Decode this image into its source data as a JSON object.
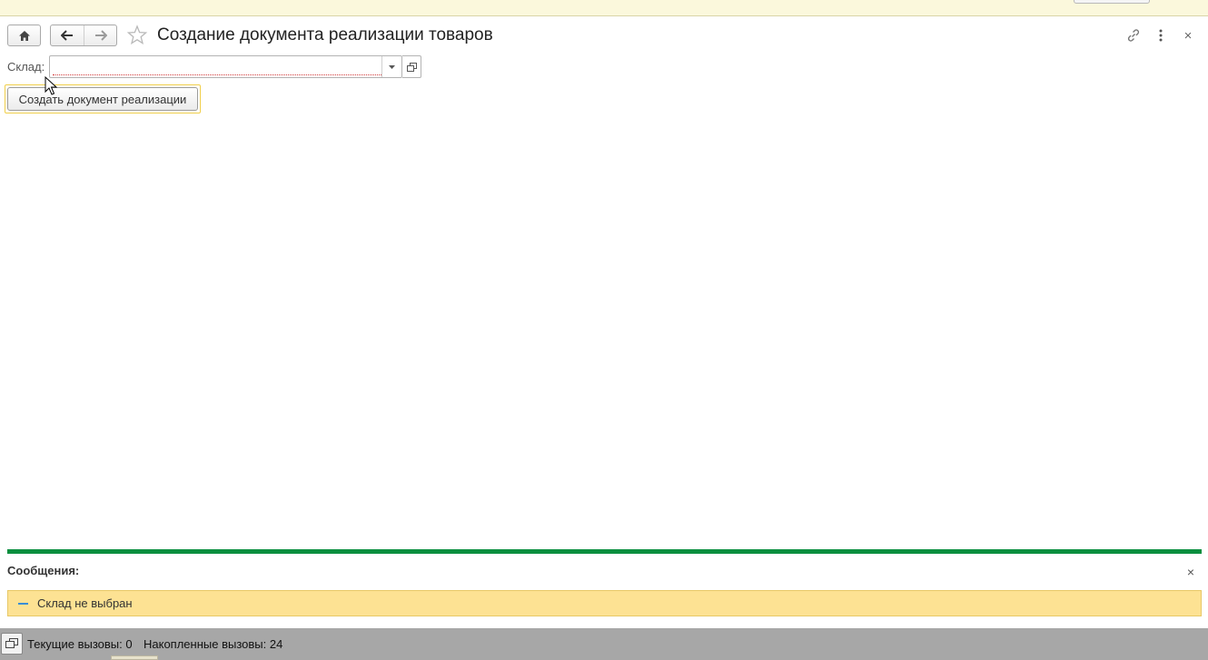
{
  "window": {
    "title": "Создание документа реализации товаров"
  },
  "nav": {
    "home_icon": "home-icon",
    "back_icon": "arrow-left-icon",
    "forward_icon": "arrow-right-icon",
    "favorite_icon": "star-icon"
  },
  "window_actions": {
    "link_icon": "link-icon",
    "more_icon": "more-vertical-icon",
    "close_icon": "close-icon",
    "close_glyph": "×"
  },
  "form": {
    "warehouse_label": "Склад:",
    "warehouse_value": "",
    "create_button_label": "Создать документ реализации"
  },
  "messages": {
    "title": "Сообщения:",
    "close_glyph": "×",
    "items": [
      {
        "text": "Склад не выбран"
      }
    ],
    "separator_color": "#0a8f3f",
    "item_background": "#fde293"
  },
  "status_bar": {
    "current_calls": "Текущие вызовы: 0",
    "accumulated_calls": "Накопленные вызовы: 24"
  }
}
